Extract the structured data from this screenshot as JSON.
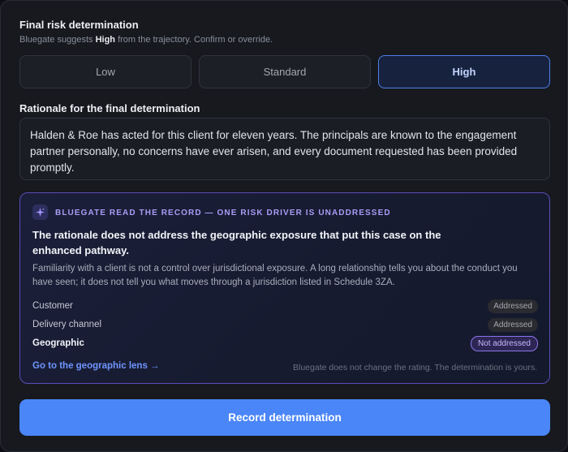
{
  "determination": {
    "title": "Final risk determination",
    "subtitle_prefix": "Bluegate suggests ",
    "suggested_level": "High",
    "subtitle_suffix": " from the trajectory. Confirm or override.",
    "options": [
      "Low",
      "Standard",
      "High"
    ],
    "selected": "High"
  },
  "rationale": {
    "label": "Rationale for the final determination",
    "value": "Halden & Roe has acted for this client for eleven years. The principals are known to the engagement partner personally, no concerns have ever arisen, and every document requested has been provided promptly."
  },
  "callout": {
    "icon": "sparkle-icon",
    "eyebrow": "BLUEGATE READ THE RECORD — ONE RISK DRIVER IS UNADDRESSED",
    "heading": "The rationale does not address the geographic exposure that put this case on the enhanced pathway.",
    "body": "Familiarity with a client is not a control over jurisdictional exposure. A long relationship tells you about the conduct you have seen; it does not tell you what moves through a jurisdiction listed in Schedule 3ZA.",
    "drivers": [
      {
        "name": "Customer",
        "status": "Addressed"
      },
      {
        "name": "Delivery channel",
        "status": "Addressed"
      },
      {
        "name": "Geographic",
        "status": "Not addressed"
      }
    ],
    "link": "Go to the geographic lens →",
    "disclaimer": "Bluegate does not change the rating. The determination is yours."
  },
  "actions": {
    "record_label": "Record determination"
  },
  "colors": {
    "accent": "#4a86f7",
    "callout_border": "#5b4bb8",
    "warning_badge": "#8a75ea"
  }
}
